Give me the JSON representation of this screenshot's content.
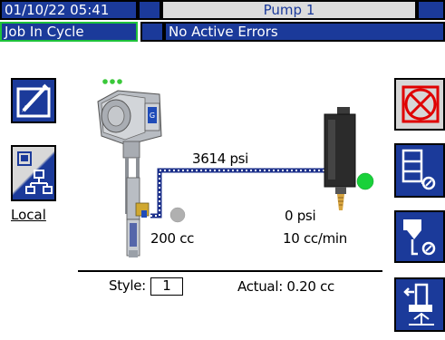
{
  "header": {
    "datetime": "01/10/22 05:41",
    "title": "Pump 1",
    "status": "Job In Cycle",
    "errors": "No Active Errors"
  },
  "left_panel": {
    "local_label": "Local"
  },
  "diagram": {
    "pressure_line": "3614 psi",
    "pump_volume": "200 cc",
    "outlet_pressure": "0 psi",
    "flow_rate": "10 cc/min",
    "status_colors": {
      "ok": "#19d13a",
      "idle": "#b0b0b0",
      "indicator_dots": "#3ac83a"
    }
  },
  "footer": {
    "style_label": "Style:",
    "style_value": "1",
    "actual_label": "Actual: 0.20 cc"
  },
  "icons": {
    "edit": "edit-icon",
    "network": "network-icon",
    "stop": "stop-icon",
    "recipe": "recipe-icon",
    "dispense": "dispense-valve-icon",
    "pump": "pump-icon"
  }
}
